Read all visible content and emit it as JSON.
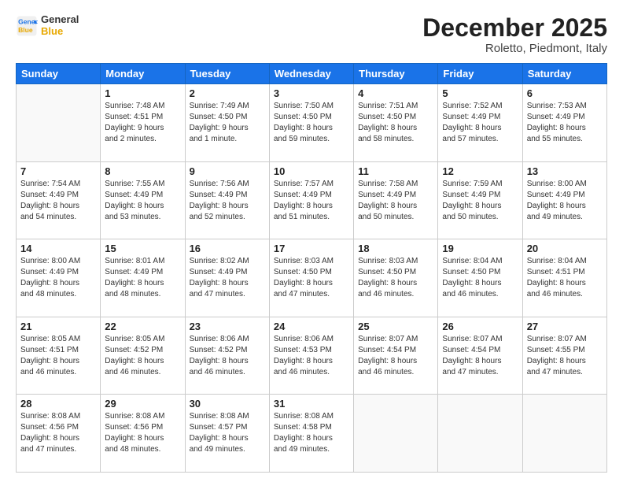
{
  "logo": {
    "line1": "General",
    "line2": "Blue"
  },
  "title": "December 2025",
  "subtitle": "Roletto, Piedmont, Italy",
  "days_of_week": [
    "Sunday",
    "Monday",
    "Tuesday",
    "Wednesday",
    "Thursday",
    "Friday",
    "Saturday"
  ],
  "weeks": [
    [
      {
        "day": "",
        "info": ""
      },
      {
        "day": "1",
        "info": "Sunrise: 7:48 AM\nSunset: 4:51 PM\nDaylight: 9 hours\nand 2 minutes."
      },
      {
        "day": "2",
        "info": "Sunrise: 7:49 AM\nSunset: 4:50 PM\nDaylight: 9 hours\nand 1 minute."
      },
      {
        "day": "3",
        "info": "Sunrise: 7:50 AM\nSunset: 4:50 PM\nDaylight: 8 hours\nand 59 minutes."
      },
      {
        "day": "4",
        "info": "Sunrise: 7:51 AM\nSunset: 4:50 PM\nDaylight: 8 hours\nand 58 minutes."
      },
      {
        "day": "5",
        "info": "Sunrise: 7:52 AM\nSunset: 4:49 PM\nDaylight: 8 hours\nand 57 minutes."
      },
      {
        "day": "6",
        "info": "Sunrise: 7:53 AM\nSunset: 4:49 PM\nDaylight: 8 hours\nand 55 minutes."
      }
    ],
    [
      {
        "day": "7",
        "info": "Sunrise: 7:54 AM\nSunset: 4:49 PM\nDaylight: 8 hours\nand 54 minutes."
      },
      {
        "day": "8",
        "info": "Sunrise: 7:55 AM\nSunset: 4:49 PM\nDaylight: 8 hours\nand 53 minutes."
      },
      {
        "day": "9",
        "info": "Sunrise: 7:56 AM\nSunset: 4:49 PM\nDaylight: 8 hours\nand 52 minutes."
      },
      {
        "day": "10",
        "info": "Sunrise: 7:57 AM\nSunset: 4:49 PM\nDaylight: 8 hours\nand 51 minutes."
      },
      {
        "day": "11",
        "info": "Sunrise: 7:58 AM\nSunset: 4:49 PM\nDaylight: 8 hours\nand 50 minutes."
      },
      {
        "day": "12",
        "info": "Sunrise: 7:59 AM\nSunset: 4:49 PM\nDaylight: 8 hours\nand 50 minutes."
      },
      {
        "day": "13",
        "info": "Sunrise: 8:00 AM\nSunset: 4:49 PM\nDaylight: 8 hours\nand 49 minutes."
      }
    ],
    [
      {
        "day": "14",
        "info": "Sunrise: 8:00 AM\nSunset: 4:49 PM\nDaylight: 8 hours\nand 48 minutes."
      },
      {
        "day": "15",
        "info": "Sunrise: 8:01 AM\nSunset: 4:49 PM\nDaylight: 8 hours\nand 48 minutes."
      },
      {
        "day": "16",
        "info": "Sunrise: 8:02 AM\nSunset: 4:49 PM\nDaylight: 8 hours\nand 47 minutes."
      },
      {
        "day": "17",
        "info": "Sunrise: 8:03 AM\nSunset: 4:50 PM\nDaylight: 8 hours\nand 47 minutes."
      },
      {
        "day": "18",
        "info": "Sunrise: 8:03 AM\nSunset: 4:50 PM\nDaylight: 8 hours\nand 46 minutes."
      },
      {
        "day": "19",
        "info": "Sunrise: 8:04 AM\nSunset: 4:50 PM\nDaylight: 8 hours\nand 46 minutes."
      },
      {
        "day": "20",
        "info": "Sunrise: 8:04 AM\nSunset: 4:51 PM\nDaylight: 8 hours\nand 46 minutes."
      }
    ],
    [
      {
        "day": "21",
        "info": "Sunrise: 8:05 AM\nSunset: 4:51 PM\nDaylight: 8 hours\nand 46 minutes."
      },
      {
        "day": "22",
        "info": "Sunrise: 8:05 AM\nSunset: 4:52 PM\nDaylight: 8 hours\nand 46 minutes."
      },
      {
        "day": "23",
        "info": "Sunrise: 8:06 AM\nSunset: 4:52 PM\nDaylight: 8 hours\nand 46 minutes."
      },
      {
        "day": "24",
        "info": "Sunrise: 8:06 AM\nSunset: 4:53 PM\nDaylight: 8 hours\nand 46 minutes."
      },
      {
        "day": "25",
        "info": "Sunrise: 8:07 AM\nSunset: 4:54 PM\nDaylight: 8 hours\nand 46 minutes."
      },
      {
        "day": "26",
        "info": "Sunrise: 8:07 AM\nSunset: 4:54 PM\nDaylight: 8 hours\nand 47 minutes."
      },
      {
        "day": "27",
        "info": "Sunrise: 8:07 AM\nSunset: 4:55 PM\nDaylight: 8 hours\nand 47 minutes."
      }
    ],
    [
      {
        "day": "28",
        "info": "Sunrise: 8:08 AM\nSunset: 4:56 PM\nDaylight: 8 hours\nand 47 minutes."
      },
      {
        "day": "29",
        "info": "Sunrise: 8:08 AM\nSunset: 4:56 PM\nDaylight: 8 hours\nand 48 minutes."
      },
      {
        "day": "30",
        "info": "Sunrise: 8:08 AM\nSunset: 4:57 PM\nDaylight: 8 hours\nand 49 minutes."
      },
      {
        "day": "31",
        "info": "Sunrise: 8:08 AM\nSunset: 4:58 PM\nDaylight: 8 hours\nand 49 minutes."
      },
      {
        "day": "",
        "info": ""
      },
      {
        "day": "",
        "info": ""
      },
      {
        "day": "",
        "info": ""
      }
    ]
  ]
}
